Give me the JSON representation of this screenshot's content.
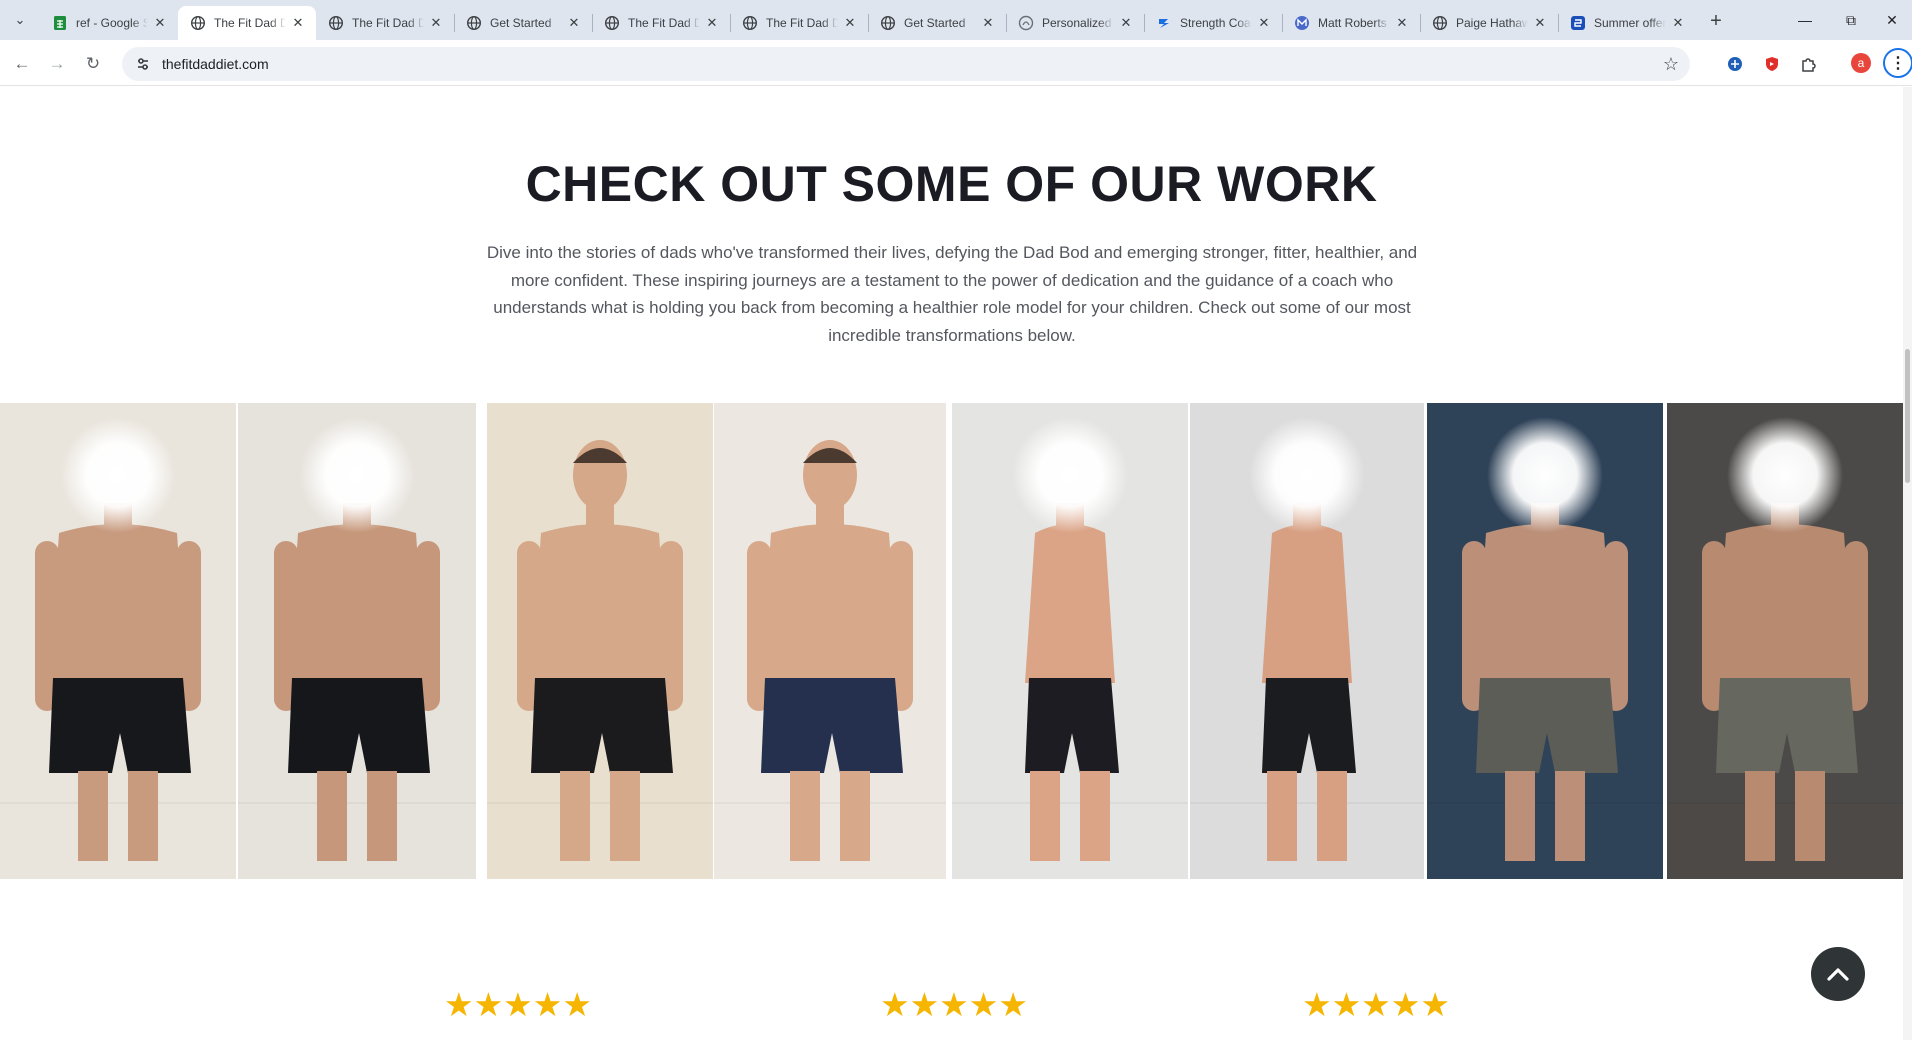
{
  "browser": {
    "tabs": [
      {
        "title": "ref - Google Sheets",
        "favicon": "sheets-icon",
        "active": false
      },
      {
        "title": "The Fit Dad Diet",
        "favicon": "globe-icon",
        "active": true
      },
      {
        "title": "The Fit Dad Diet",
        "favicon": "globe-icon",
        "active": false
      },
      {
        "title": "Get Started",
        "favicon": "globe-icon",
        "active": false
      },
      {
        "title": "The Fit Dad Diet",
        "favicon": "globe-icon",
        "active": false
      },
      {
        "title": "The Fit Dad Diet",
        "favicon": "globe-icon",
        "active": false
      },
      {
        "title": "Get Started",
        "favicon": "globe-icon",
        "active": false
      },
      {
        "title": "Personalized",
        "favicon": "site-icon",
        "active": false
      },
      {
        "title": "Strength Coach",
        "favicon": "strength-icon",
        "active": false
      },
      {
        "title": "Matt Roberts",
        "favicon": "mr-icon",
        "active": false
      },
      {
        "title": "Paige Hathaway",
        "favicon": "globe-icon",
        "active": false
      },
      {
        "title": "Summer offer",
        "favicon": "summer-icon",
        "active": false
      }
    ],
    "url": "thefitdaddiet.com",
    "profile_initial": "a",
    "colors": {
      "tabstrip": "#dfe5ef",
      "accent": "#1a73e8",
      "profile": "#e8453c"
    }
  },
  "section": {
    "heading": "CHECK OUT SOME OF OUR WORK",
    "intro": "Dive into the stories of dads who've transformed their lives, defying the Dad Bod and emerging stronger, fitter, healthier, and more confident. These inspiring journeys are a testament to the power of dedication and the guidance of a coach who understands what is holding you back from becoming a healthier role model for your children. Check out some of our most incredible transformations below."
  },
  "gallery": {
    "photos": [
      {
        "name": "transformation-1-before",
        "wall": "#e9e4dc",
        "shorts": "#17181c",
        "skin": "#c89a7e",
        "face_blurred": true
      },
      {
        "name": "transformation-1-after",
        "wall": "#e6e2dc",
        "shorts": "#15171b",
        "skin": "#c6977a",
        "face_blurred": true
      },
      {
        "name": "transformation-2-before",
        "wall": "#e9dfcf",
        "shorts": "#1b1b1e",
        "skin": "#d4a888",
        "face_blurred": false
      },
      {
        "name": "transformation-2-after",
        "wall": "#ece8e1",
        "shorts": "#24304e",
        "skin": "#d7a98a",
        "face_blurred": false
      },
      {
        "name": "transformation-3-before",
        "wall": "#e4e4e2",
        "shorts": "#1d1c22",
        "skin": "#dba487",
        "face_blurred": true
      },
      {
        "name": "transformation-3-after",
        "wall": "#dcdcdc",
        "shorts": "#1b1c20",
        "skin": "#d7a083",
        "face_blurred": true
      },
      {
        "name": "transformation-4-before",
        "wall": "#2e4258",
        "shorts": "#5c5d57",
        "skin": "#bb8f78",
        "face_blurred": true
      },
      {
        "name": "transformation-4-after",
        "wall": "#4c4a48",
        "shorts": "#66675f",
        "skin": "#b88a70",
        "face_blurred": true
      }
    ]
  },
  "reviews": [
    {
      "stars": "★★★★★",
      "rating": 5
    },
    {
      "stars": "★★★★★",
      "rating": 5
    },
    {
      "stars": "★★★★★",
      "rating": 5
    }
  ]
}
